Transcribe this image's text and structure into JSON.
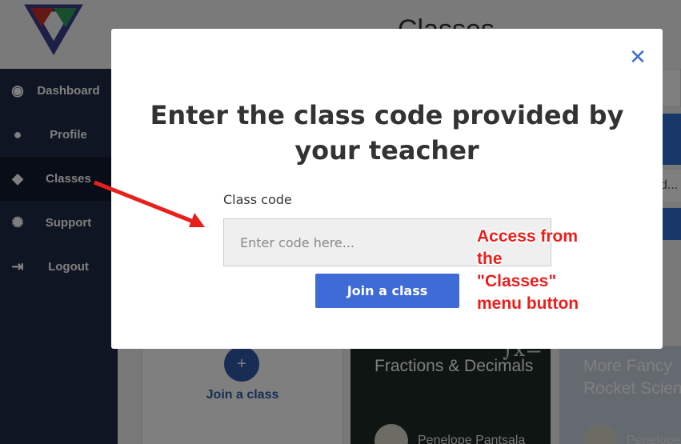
{
  "header": {
    "page_title": "Classes"
  },
  "sidebar": {
    "items": [
      {
        "label": "Dashboard",
        "icon": "user-circle-icon"
      },
      {
        "label": "Profile",
        "icon": "person-icon"
      },
      {
        "label": "Classes",
        "icon": "graduation-cap-icon",
        "active": true
      },
      {
        "label": "Support",
        "icon": "lightbulb-icon"
      },
      {
        "label": "Logout",
        "icon": "logout-icon"
      }
    ]
  },
  "background": {
    "strip_text": "d...",
    "join_card": {
      "plus": "+",
      "label": "Join a class"
    },
    "class_cards": [
      {
        "title": "Fractions & Decimals",
        "owner": "Penelope Pantsala"
      },
      {
        "title": "More Fancy Rocket Scien",
        "owner": "Penelope"
      }
    ]
  },
  "modal": {
    "close_glyph": "✕",
    "heading": "Enter the class code provided by your teacher",
    "field_label": "Class code",
    "input_placeholder": "Enter code here...",
    "input_value": "",
    "button_label": "Join a class"
  },
  "annotation": {
    "lines": [
      "Access from",
      "the",
      "\"Classes\"",
      "menu button"
    ],
    "color": "#e8201c"
  },
  "colors": {
    "accent": "#3f6bd6",
    "sidebar": "#1f2a44",
    "arrow": "#e8201c"
  }
}
